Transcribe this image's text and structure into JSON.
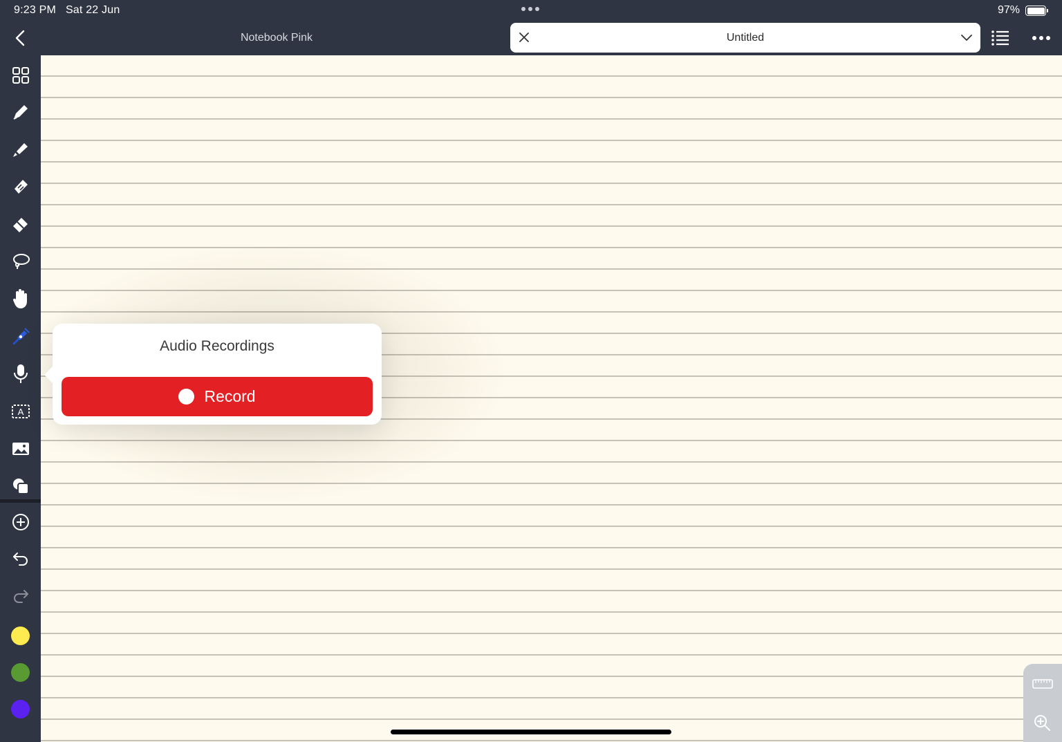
{
  "status": {
    "time": "9:23 PM",
    "date": "Sat 22 Jun",
    "battery": "97%"
  },
  "header": {
    "notebook_title": "Notebook Pink",
    "doc_title": "Untitled"
  },
  "sidebar": {
    "tools": [
      {
        "name": "pages-grid-icon"
      },
      {
        "name": "pen-icon"
      },
      {
        "name": "highlighter-icon"
      },
      {
        "name": "tape-icon"
      },
      {
        "name": "eraser-icon"
      },
      {
        "name": "lasso-icon"
      },
      {
        "name": "hand-icon"
      },
      {
        "name": "laser-pointer-icon"
      },
      {
        "name": "microphone-icon"
      },
      {
        "name": "text-box-icon"
      },
      {
        "name": "image-icon"
      },
      {
        "name": "shapes-icon"
      }
    ],
    "colors": [
      "#fdeb4f",
      "#5a9a33",
      "#5b21f0"
    ]
  },
  "popover": {
    "title": "Audio Recordings",
    "record_label": "Record"
  },
  "colors": {
    "chrome": "#2f3542",
    "paper": "#fefaed",
    "record": "#e32023"
  }
}
